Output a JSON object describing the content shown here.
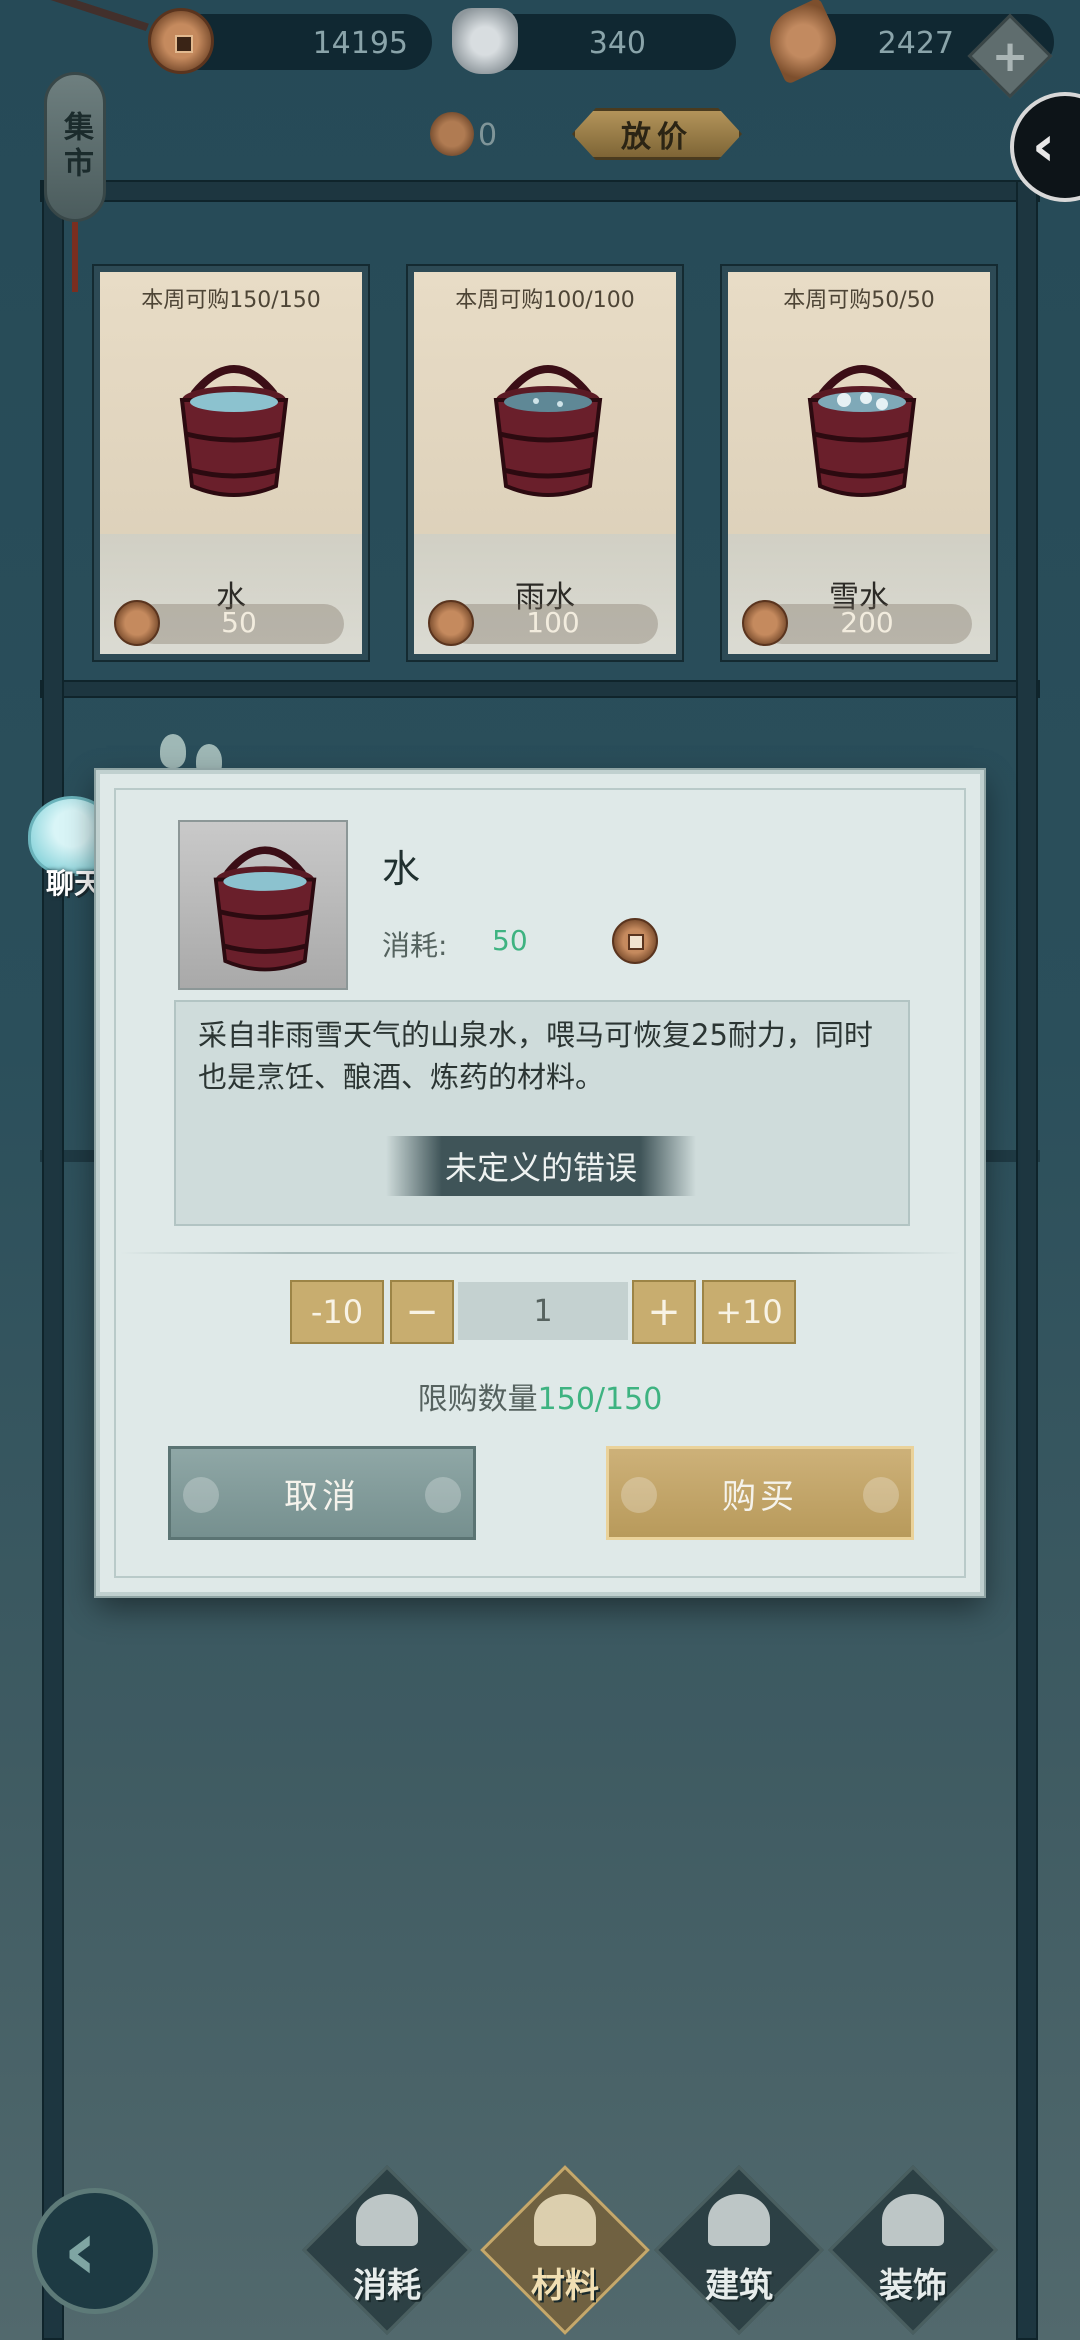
{
  "currency": {
    "copper": "14195",
    "silver": "340",
    "leaf": "2427"
  },
  "market": {
    "tag": "集市",
    "bid_count": "0",
    "bid_button": "放价"
  },
  "items": [
    {
      "stock": "本周可购150/150",
      "name": "水",
      "price": "50"
    },
    {
      "stock": "本周可购100/100",
      "name": "雨水",
      "price": "100"
    },
    {
      "stock": "本周可购50/50",
      "name": "雪水",
      "price": "200"
    }
  ],
  "chat": {
    "label": "聊天"
  },
  "dialog": {
    "title": "水",
    "cost_label": "消耗:",
    "cost_value": "50",
    "description": "采自非雨雪天气的山泉水，喂马可恢复25耐力，同时也是烹饪、酿酒、炼药的材料。",
    "error_text": "未定义的错误",
    "minus10": "-10",
    "minus": "−",
    "quantity": "1",
    "plus": "+",
    "plus10": "+10",
    "limit_label": "限购数量",
    "limit_value": "150/150",
    "cancel": "取消",
    "buy": "购买"
  },
  "nav": {
    "tabs": [
      "消耗",
      "材料",
      "建筑",
      "装饰"
    ],
    "active": "材料"
  },
  "colors": {
    "accent_green": "#3eb381",
    "gold_button": "#c8ad6f",
    "panel_bg": "#dfe9e8"
  }
}
